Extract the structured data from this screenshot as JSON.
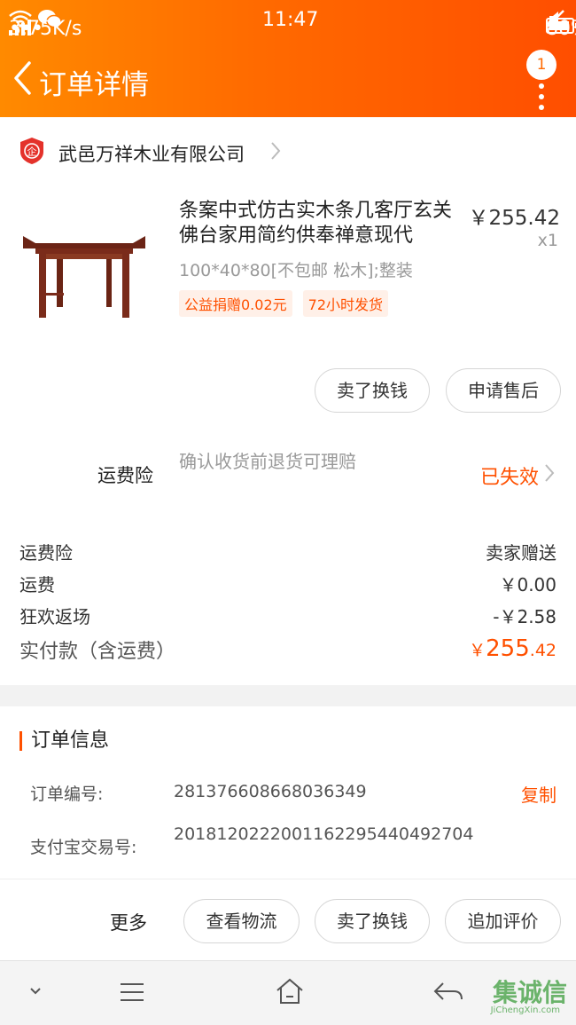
{
  "status_bar": {
    "speed": "3.75K/s",
    "time": "11:47",
    "battery": "80%",
    "extra": "•••"
  },
  "header": {
    "title": "订单详情",
    "badge_count": "1"
  },
  "shop": {
    "name": "武邑万祥木业有限公司",
    "icon_text": "企"
  },
  "product": {
    "title": "条案中式仿古实木条几客厅玄关佛台家用简约供奉禅意现代",
    "price": "￥255.42",
    "quantity": "x1",
    "spec": "100*40*80[不包邮 松木];整装",
    "tags": [
      "公益捐赠0.02元",
      "72小时发货"
    ]
  },
  "item_actions": {
    "sell": "卖了换钱",
    "after_sale": "申请售后"
  },
  "insurance": {
    "label": "运费险",
    "desc": "确认收货前退货可理赔",
    "status": "已失效"
  },
  "summary": [
    {
      "key": "运费险",
      "value": "卖家赠送"
    },
    {
      "key": "运费",
      "value": "￥0.00"
    },
    {
      "key": "狂欢返场",
      "value": "-￥2.58"
    }
  ],
  "total": {
    "label": "实付款（含运费）",
    "currency": "￥",
    "integer": "255",
    "decimal": ".42"
  },
  "order_info": {
    "title": "订单信息",
    "order_no_label": "订单编号:",
    "order_no": "281376608668036349",
    "copy_label": "复制",
    "alipay_label": "支付宝交易号:",
    "alipay_no": "2018120222001162295440492704"
  },
  "bottom_actions": {
    "more": "更多",
    "logistics": "查看物流",
    "sell": "卖了换钱",
    "review": "追加评价"
  },
  "watermark": {
    "text": "集诚信",
    "sub": "JiChengXin.com"
  },
  "colors": {
    "accent": "#ff5000",
    "header_start": "#ff8a00",
    "header_end": "#ff4e00"
  }
}
